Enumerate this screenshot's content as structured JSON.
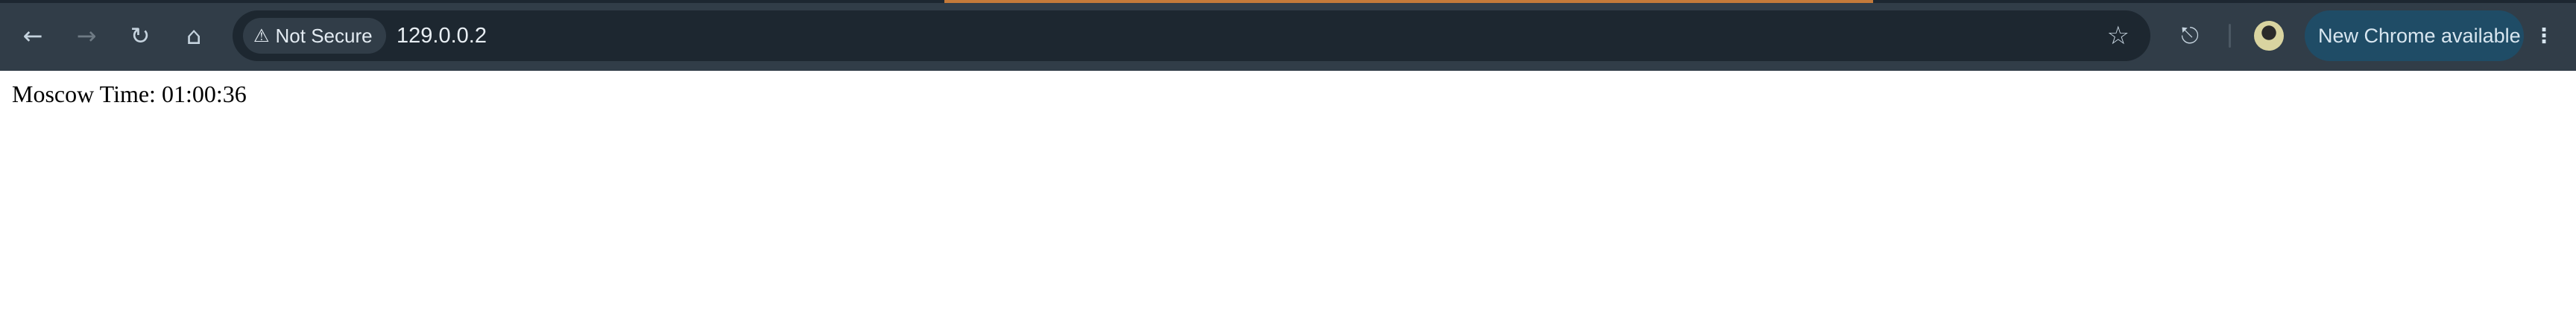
{
  "browser": {
    "security_label": "Not Secure",
    "url": "129.0.0.2",
    "update_label": "New Chrome available",
    "icons": [
      "back-icon",
      "forward-icon",
      "reload-icon",
      "home-icon",
      "warning-icon",
      "star-icon",
      "extensions-icon",
      "avatar",
      "more-icon"
    ]
  },
  "page": {
    "text": "Moscow Time: 01:00:36"
  }
}
